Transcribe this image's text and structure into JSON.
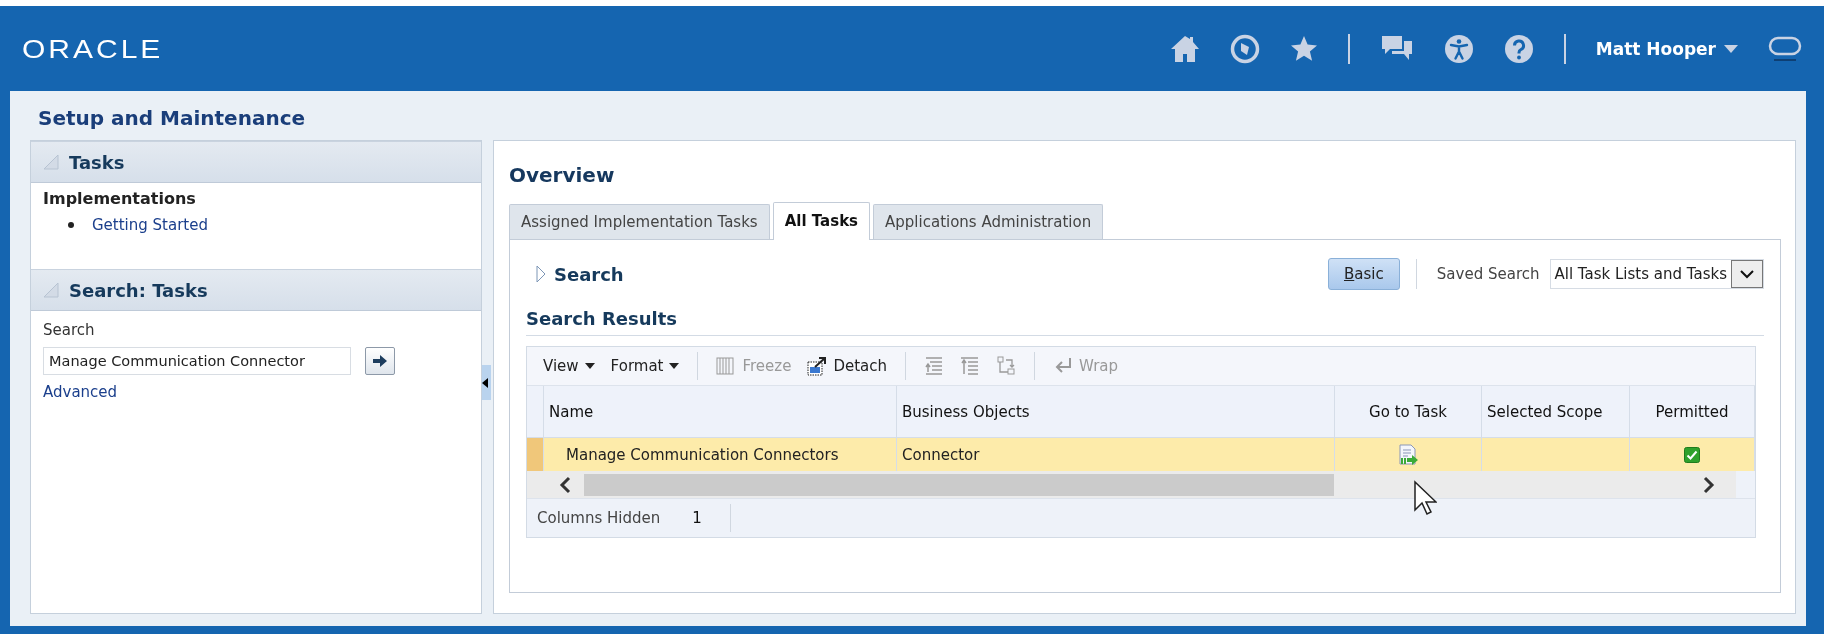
{
  "header": {
    "logo": "ORACLE",
    "user_name": "Matt Hooper"
  },
  "page_title": "Setup and Maintenance",
  "tasks_panel": {
    "title": "Tasks",
    "expanded": true,
    "section": "Implementations",
    "items": [
      "Getting Started"
    ]
  },
  "search_panel": {
    "title": "Search: Tasks",
    "expanded": true,
    "label": "Search",
    "value": "Manage Communication Connector",
    "link": "Advanced"
  },
  "overview": {
    "title": "Overview",
    "tabs": [
      {
        "label": "Assigned Implementation Tasks",
        "selected": false
      },
      {
        "label": "All Tasks",
        "selected": true
      },
      {
        "label": "Applications Administration",
        "selected": false
      }
    ],
    "search": {
      "label": "Search",
      "expanded": false,
      "mode_button": "Basic",
      "saved_search_label": "Saved Search",
      "saved_search_value": "All Task Lists and Tasks"
    },
    "results": {
      "title": "Search Results",
      "toolbar": [
        {
          "kind": "menu",
          "label": "View",
          "disabled": false
        },
        {
          "kind": "menu",
          "label": "Format",
          "disabled": false
        },
        {
          "kind": "separator"
        },
        {
          "kind": "button",
          "label": "Freeze",
          "disabled": true
        },
        {
          "kind": "button",
          "label": "Detach",
          "disabled": false
        },
        {
          "kind": "separator"
        },
        {
          "kind": "icon-button",
          "disabled": true
        },
        {
          "kind": "icon-button",
          "disabled": true
        },
        {
          "kind": "icon-button",
          "disabled": true
        },
        {
          "kind": "separator"
        },
        {
          "kind": "button",
          "label": "Wrap",
          "disabled": true
        }
      ],
      "columns": [
        {
          "label": "Name"
        },
        {
          "label": "Business Objects"
        },
        {
          "label": "Go to Task"
        },
        {
          "label": "Selected Scope"
        },
        {
          "label": "Permitted"
        }
      ],
      "rows": [
        {
          "name": "Manage Communication Connectors",
          "business_objects": "Connector",
          "go_to_task": true,
          "permitted": true,
          "selected": true
        }
      ],
      "footer": {
        "label": "Columns Hidden",
        "value": "1"
      }
    }
  }
}
